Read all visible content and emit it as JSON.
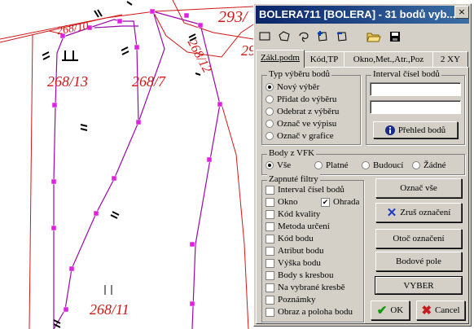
{
  "map": {
    "parcels": [
      "268/10",
      "268/13",
      "268/7",
      "268/12",
      "268/11",
      "293/",
      "29"
    ]
  },
  "dialog": {
    "title": "BOLERA711 [BOLERA] - 31 bodů vyb...",
    "close_glyph": "×",
    "toolbar": [
      "rectangle-select-icon",
      "polygon-select-icon",
      "lasso-select-icon",
      "add-selection-icon",
      "remove-selection-icon",
      "open-folder-icon",
      "save-disk-icon"
    ],
    "tabs": [
      "Zákl.podm",
      "Kód,TP",
      "Okno,Met.,Atr.,Poz",
      "2 XY"
    ],
    "typ_vyberu": {
      "label": "Typ výběru bodů",
      "options": [
        "Nový výběr",
        "Přidat do výběru",
        "Odebrat z výběru",
        "Označ ve výpisu",
        "Označ v grafice"
      ],
      "selected": 0
    },
    "interval": {
      "label": "Interval čísel bodů",
      "from": "",
      "to": "",
      "button": "Přehled bodů"
    },
    "body_z_vfk": {
      "label": "Body z VFK",
      "options": [
        "Vše",
        "Platné",
        "Budoucí",
        "Žádné"
      ],
      "selected": 0
    },
    "filtry": {
      "label": "Zapnuté filtry",
      "items": [
        "Interval čísel bodů",
        "Okno",
        "Kód kvality",
        "Metoda určení",
        "Kód bodu",
        "Atribut bodu",
        "Výška bodu",
        "Body s kresbou",
        "Na vybrané kresbě",
        "Poznámky",
        "Obraz a poloha bodu"
      ],
      "ohrada_label": "Ohrada",
      "ohrada_checked": true
    },
    "buttons": {
      "oznac_vse": "Označ vše",
      "zrus_oznaceni": "Zruš označení",
      "otoc_oznaceni": "Otoč označení",
      "bodove_pole": "Bodové pole",
      "vyber": "VYBER",
      "ok": "OK",
      "cancel": "Cancel"
    }
  }
}
